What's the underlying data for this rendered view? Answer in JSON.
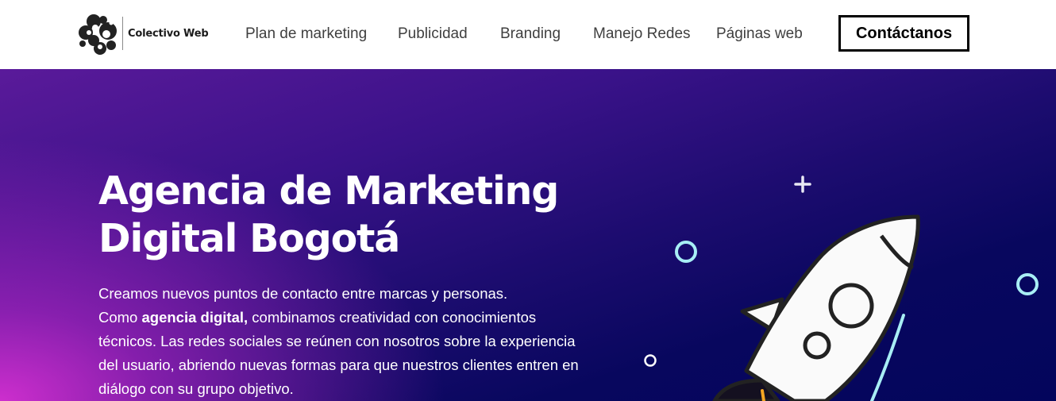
{
  "brand": {
    "name": "Colectivo Web"
  },
  "nav": {
    "items": [
      {
        "label": "Plan de marketing"
      },
      {
        "label": "Publicidad"
      },
      {
        "label": "Branding"
      },
      {
        "label": "Manejo Redes"
      },
      {
        "label": "Páginas web"
      }
    ],
    "cta_label": "Contáctanos"
  },
  "hero": {
    "title_line1": "Agencia de Marketing",
    "title_line2": "Digital Bogotá",
    "intro": "Creamos nuevos puntos de contacto entre marcas y personas.",
    "body_prefix": "Como ",
    "body_bold": "agencia digital,",
    "body_rest": " combinamos creatividad con conocimientos técnicos. Las redes sociales se reúnen con nosotros sobre la experiencia del usuario, abriendo nuevas formas para que nuestros clientes entren en diálogo con su grupo objetivo."
  },
  "icons": {
    "logo": "blob-cluster-logo-icon",
    "rocket": "rocket-icon",
    "sparkle": "plus-sparkle-icon",
    "ring": "ring-icon"
  },
  "colors": {
    "hero_dark": "#03055c",
    "hero_pink": "#d630d2",
    "ring_cyan": "#a8eef5",
    "flame_orange": "#f5a623",
    "nav_text": "#3f3f3f"
  }
}
